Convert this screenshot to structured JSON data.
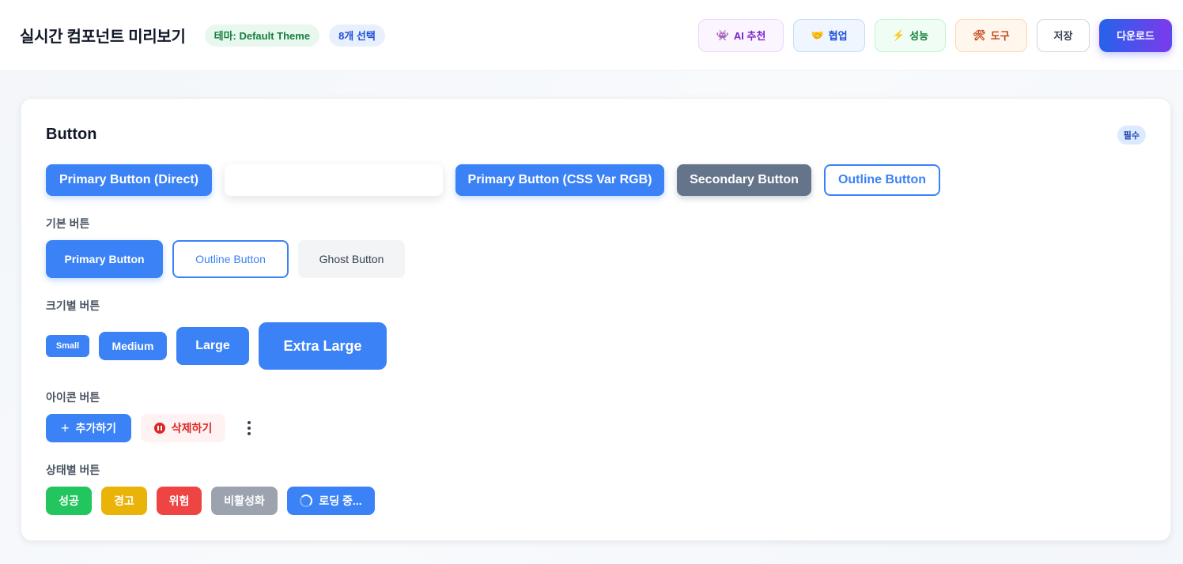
{
  "header": {
    "title": "실시간 컴포넌트 미리보기",
    "theme_pill": "테마: Default Theme",
    "selection_pill": "8개 선택",
    "actions": {
      "ai": {
        "icon": "👾",
        "label": "AI 추천"
      },
      "collab": {
        "icon": "🤝",
        "label": "협업"
      },
      "perf": {
        "icon": "⚡",
        "label": "성능"
      },
      "tools": {
        "icon": "🛠",
        "label": "도구"
      },
      "save": "저장",
      "download": "다운로드"
    }
  },
  "card": {
    "title": "Button",
    "badge": "필수",
    "top_row": {
      "primary_direct": "Primary Button (Direct)",
      "primary_css_var": "Primary Button (CSS Var RGB)",
      "secondary": "Secondary Button",
      "outline": "Outline Button"
    },
    "basic": {
      "label": "기본 버튼",
      "primary": "Primary Button",
      "outline": "Outline Button",
      "ghost": "Ghost Button"
    },
    "sizes": {
      "label": "크기별 버튼",
      "small": "Small",
      "medium": "Medium",
      "large": "Large",
      "xlarge": "Extra Large"
    },
    "icons": {
      "label": "아이콘 버튼",
      "add_icon": "+",
      "add": "추가하기",
      "delete": "삭제하기"
    },
    "states": {
      "label": "상태별 버튼",
      "success": "성공",
      "warning": "경고",
      "danger": "위험",
      "disabled": "비활성화",
      "loading": "로딩 중..."
    }
  },
  "colors": {
    "primary": "#3b82f6",
    "secondary": "#64748b",
    "success": "#22c55e",
    "warning": "#eab308",
    "danger": "#ef4444",
    "disabled": "#9ca3af"
  }
}
